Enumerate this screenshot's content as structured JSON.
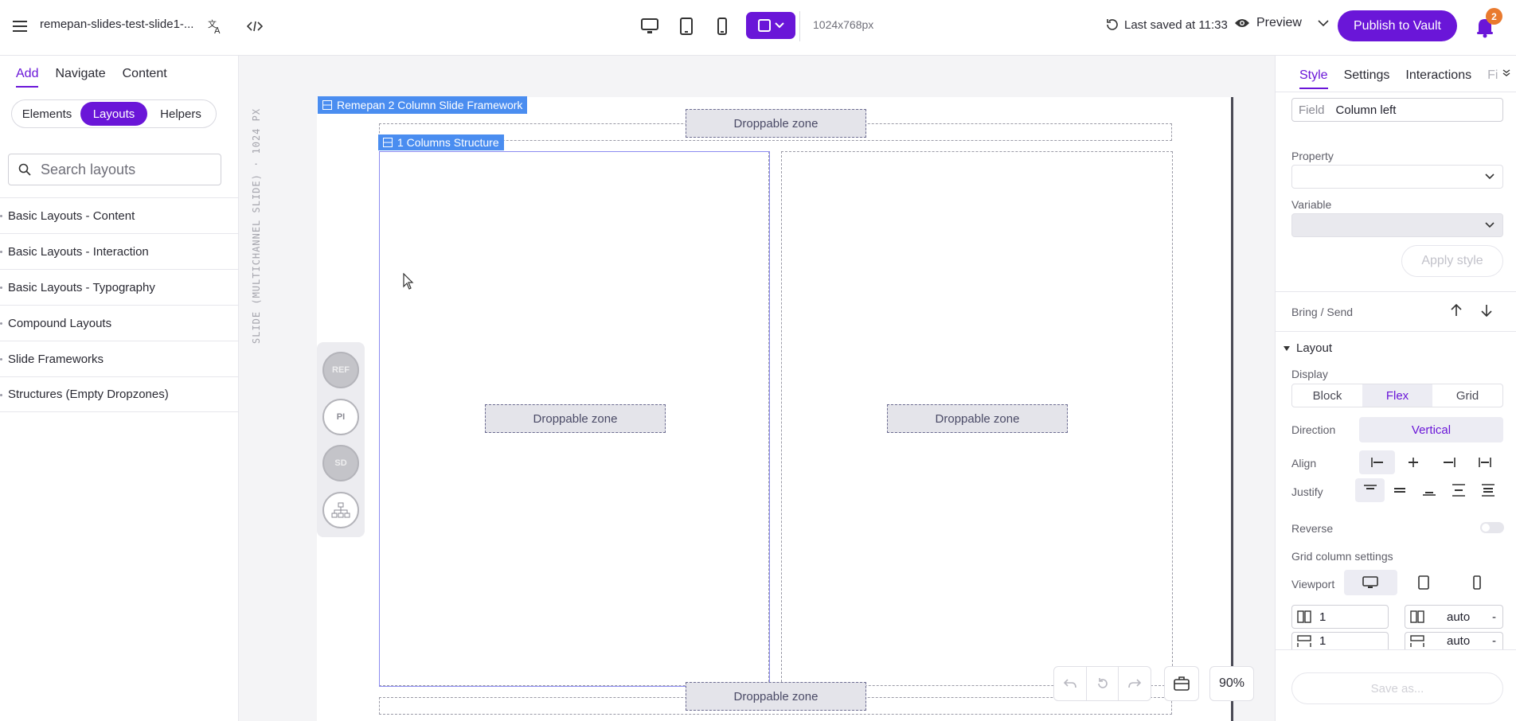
{
  "topbar": {
    "doc_title": "remepan-slides-test-slide1-...",
    "dimensions": "1024x768px",
    "last_saved": "Last saved at 11:33",
    "preview_label": "Preview",
    "publish_label": "Publish to Vault",
    "notification_count": "2",
    "accent_color": "#6a16d8"
  },
  "left": {
    "tabs": [
      "Add",
      "Navigate",
      "Content"
    ],
    "active_tab": "Add",
    "segments": [
      "Elements",
      "Layouts",
      "Helpers"
    ],
    "active_segment": "Layouts",
    "search_placeholder": "Search layouts",
    "categories": [
      "Basic Layouts - Content",
      "Basic Layouts - Interaction",
      "Basic Layouts - Typography",
      "Compound Layouts",
      "Slide Frameworks",
      "Structures (Empty Dropzones)"
    ]
  },
  "canvas": {
    "vertical_label": "SLIDE (MULTICHANNEL SLIDE) · 1024 PX",
    "framework_label": "Remepan 2 Column Slide Framework",
    "structure_label": "1 Columns Structure",
    "dropzone_label": "Droppable zone",
    "rail": [
      "REF",
      "PI",
      "SD"
    ],
    "zoom": "90%"
  },
  "right": {
    "tabs": [
      "Style",
      "Settings",
      "Interactions",
      "Fi"
    ],
    "active_tab": "Style",
    "field_key": "Field",
    "field_value": "Column left",
    "property_label": "Property",
    "variable_label": "Variable",
    "apply_label": "Apply style",
    "bring_label": "Bring / Send",
    "layout_label": "Layout",
    "display_label": "Display",
    "display_options": [
      "Block",
      "Flex",
      "Grid"
    ],
    "display_active": "Flex",
    "direction_label": "Direction",
    "direction_value": "Vertical",
    "align_label": "Align",
    "justify_label": "Justify",
    "reverse_label": "Reverse",
    "grid_label": "Grid column settings",
    "viewport_label": "Viewport",
    "col_count": "1",
    "col_width": "auto",
    "row_count": "1",
    "row_height": "auto",
    "save_as_label": "Save as..."
  }
}
